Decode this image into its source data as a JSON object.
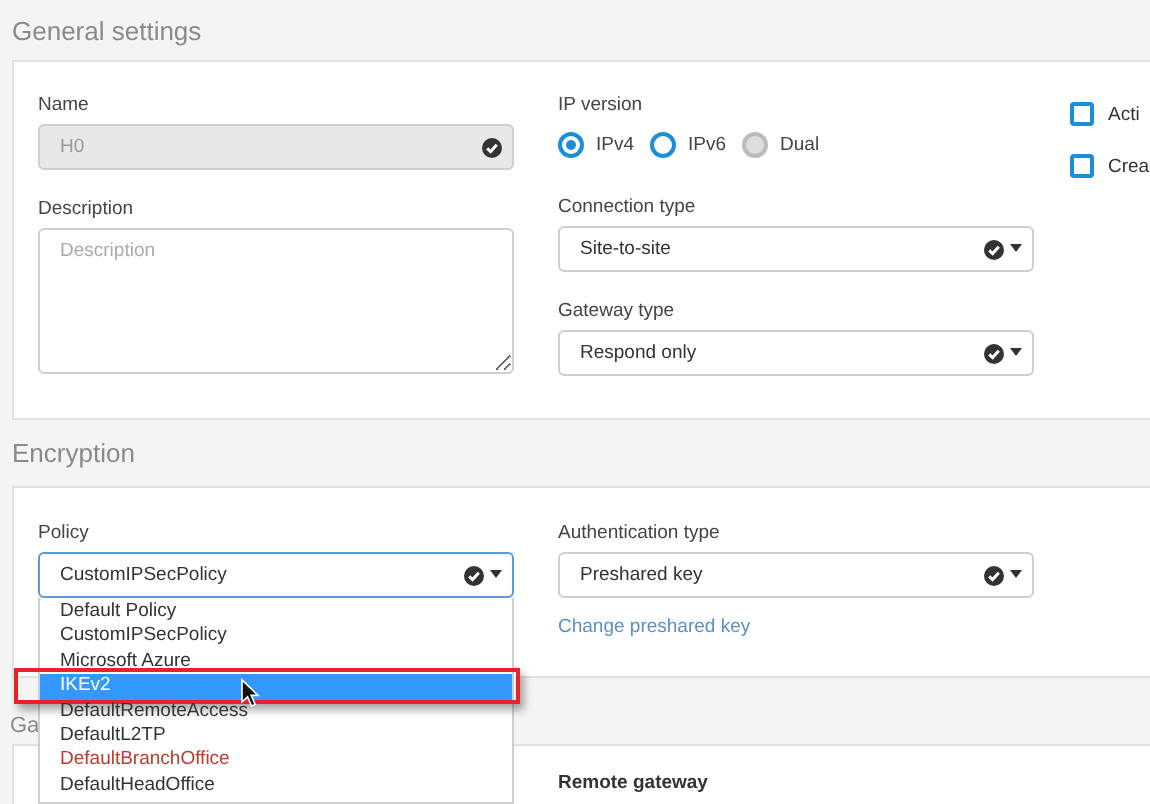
{
  "general": {
    "title": "General settings",
    "name": {
      "label": "Name",
      "value": "H0",
      "disabled": true
    },
    "description": {
      "label": "Description",
      "placeholder": "Description"
    },
    "ip_version": {
      "label": "IP version",
      "options": [
        {
          "label": "IPv4",
          "selected": true,
          "disabled": false
        },
        {
          "label": "IPv6",
          "selected": false,
          "disabled": false
        },
        {
          "label": "Dual",
          "selected": false,
          "disabled": true
        }
      ]
    },
    "connection_type": {
      "label": "Connection type",
      "value": "Site-to-site"
    },
    "gateway_type": {
      "label": "Gateway type",
      "value": "Respond only"
    },
    "checkboxes": [
      {
        "label": "Acti",
        "checked": false
      },
      {
        "label": "Crea",
        "checked": false
      }
    ]
  },
  "encryption": {
    "title": "Encryption",
    "policy": {
      "label": "Policy",
      "value": "CustomIPSecPolicy",
      "expanded": true,
      "options": [
        {
          "label": "Default Policy",
          "highlighted": false,
          "color": "#333333"
        },
        {
          "label": "CustomIPSecPolicy",
          "highlighted": false,
          "color": "#333333"
        },
        {
          "label": "Microsoft Azure",
          "highlighted": false,
          "color": "#333333"
        },
        {
          "label": "IKEv2",
          "highlighted": true,
          "color": "#ffffff"
        },
        {
          "label": "DefaultRemoteAccess",
          "highlighted": false,
          "color": "#333333"
        },
        {
          "label": "DefaultL2TP",
          "highlighted": false,
          "color": "#333333"
        },
        {
          "label": "DefaultBranchOffice",
          "highlighted": false,
          "color": "#c0392b"
        },
        {
          "label": "DefaultHeadOffice",
          "highlighted": false,
          "color": "#333333"
        }
      ]
    },
    "authentication_type": {
      "label": "Authentication type",
      "value": "Preshared key"
    },
    "link": "Change preshared key"
  },
  "gateway": {
    "title": "Ga",
    "remote_gateway_label": "Remote gateway"
  }
}
